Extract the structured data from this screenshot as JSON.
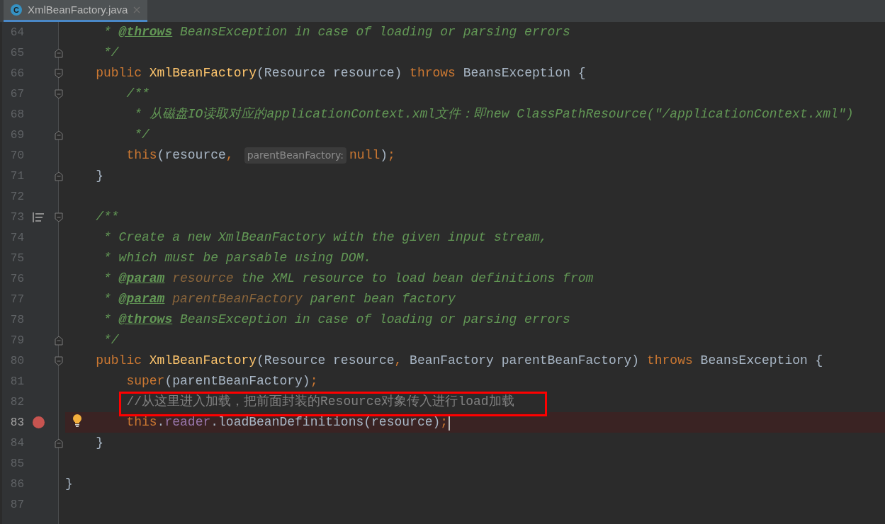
{
  "tab": {
    "icon_letter": "C",
    "title": "XmlBeanFactory.java",
    "selected": true
  },
  "lines": [
    {
      "number": "64",
      "breakpoint": false,
      "bulb": false,
      "doc_toggle": false,
      "boxed": false,
      "caret": false,
      "tokens": [
        {
          "kind": "doc",
          "text": "     * "
        },
        {
          "kind": "doctag",
          "text": "@throws"
        },
        {
          "kind": "doc",
          "text": " BeansException in case of loading or parsing errors"
        }
      ]
    },
    {
      "number": "65",
      "fold": {
        "kind": "end"
      },
      "breakpoint": false,
      "bulb": false,
      "doc_toggle": false,
      "boxed": false,
      "caret": false,
      "tokens": [
        {
          "kind": "doc",
          "text": "     */"
        }
      ]
    },
    {
      "number": "66",
      "fold": {
        "kind": "start"
      },
      "breakpoint": false,
      "bulb": false,
      "doc_toggle": false,
      "boxed": false,
      "caret": false,
      "tokens": [
        {
          "kind": "kw",
          "text": "    public "
        },
        {
          "kind": "fn",
          "text": "XmlBeanFactory"
        },
        {
          "kind": "plain",
          "text": "(Resource resource) "
        },
        {
          "kind": "kw",
          "text": "throws "
        },
        {
          "kind": "plain",
          "text": "BeansException {"
        }
      ]
    },
    {
      "number": "67",
      "fold": {
        "kind": "start"
      },
      "breakpoint": false,
      "bulb": false,
      "doc_toggle": false,
      "boxed": false,
      "caret": false,
      "tokens": [
        {
          "kind": "doc",
          "text": "        /**"
        }
      ]
    },
    {
      "number": "68",
      "breakpoint": false,
      "bulb": false,
      "doc_toggle": false,
      "boxed": false,
      "caret": false,
      "tokens": [
        {
          "kind": "doc",
          "text": "         * 从磁盘IO读取对应的applicationContext.xml文件：即new ClassPathResource(\"/applicationContext.xml\")"
        }
      ]
    },
    {
      "number": "69",
      "fold": {
        "kind": "end"
      },
      "breakpoint": false,
      "bulb": false,
      "doc_toggle": false,
      "boxed": false,
      "caret": false,
      "tokens": [
        {
          "kind": "doc",
          "text": "         */"
        }
      ]
    },
    {
      "number": "70",
      "breakpoint": false,
      "bulb": false,
      "doc_toggle": false,
      "boxed": false,
      "caret": false,
      "tokens": [
        {
          "kind": "kw",
          "text": "        this"
        },
        {
          "kind": "plain",
          "text": "(resource"
        },
        {
          "kind": "kw",
          "text": ","
        },
        {
          "kind": "hint",
          "text": "parentBeanFactory:"
        },
        {
          "kind": "kw",
          "text": "null"
        },
        {
          "kind": "plain",
          "text": ")"
        },
        {
          "kind": "kw",
          "text": ";"
        }
      ]
    },
    {
      "number": "71",
      "fold": {
        "kind": "end"
      },
      "breakpoint": false,
      "bulb": false,
      "doc_toggle": false,
      "boxed": false,
      "caret": false,
      "tokens": [
        {
          "kind": "plain",
          "text": "    }"
        }
      ]
    },
    {
      "number": "72",
      "breakpoint": false,
      "bulb": false,
      "doc_toggle": false,
      "boxed": false,
      "caret": false
    },
    {
      "number": "73",
      "fold": {
        "kind": "start"
      },
      "breakpoint": false,
      "bulb": false,
      "doc_toggle": true,
      "boxed": false,
      "caret": false,
      "tokens": [
        {
          "kind": "doc",
          "text": "    /**"
        }
      ]
    },
    {
      "number": "74",
      "breakpoint": false,
      "bulb": false,
      "doc_toggle": false,
      "boxed": false,
      "caret": false,
      "tokens": [
        {
          "kind": "doc",
          "text": "     * Create a new XmlBeanFactory with the given input stream,"
        }
      ]
    },
    {
      "number": "75",
      "breakpoint": false,
      "bulb": false,
      "doc_toggle": false,
      "boxed": false,
      "caret": false,
      "tokens": [
        {
          "kind": "doc",
          "text": "     * which must be parsable using DOM."
        }
      ]
    },
    {
      "number": "76",
      "breakpoint": false,
      "bulb": false,
      "doc_toggle": false,
      "boxed": false,
      "caret": false,
      "tokens": [
        {
          "kind": "doc",
          "text": "     * "
        },
        {
          "kind": "doctag",
          "text": "@param"
        },
        {
          "kind": "docref",
          "text": " resource"
        },
        {
          "kind": "doc",
          "text": " the XML resource to load bean definitions from"
        }
      ]
    },
    {
      "number": "77",
      "breakpoint": false,
      "bulb": false,
      "doc_toggle": false,
      "boxed": false,
      "caret": false,
      "tokens": [
        {
          "kind": "doc",
          "text": "     * "
        },
        {
          "kind": "doctag",
          "text": "@param"
        },
        {
          "kind": "docref",
          "text": " parentBeanFactory"
        },
        {
          "kind": "doc",
          "text": " parent bean factory"
        }
      ]
    },
    {
      "number": "78",
      "breakpoint": false,
      "bulb": false,
      "doc_toggle": false,
      "boxed": false,
      "caret": false,
      "tokens": [
        {
          "kind": "doc",
          "text": "     * "
        },
        {
          "kind": "doctag",
          "text": "@throws"
        },
        {
          "kind": "doc",
          "text": " BeansException in case of loading or parsing errors"
        }
      ]
    },
    {
      "number": "79",
      "fold": {
        "kind": "end"
      },
      "breakpoint": false,
      "bulb": false,
      "doc_toggle": false,
      "boxed": false,
      "caret": false,
      "tokens": [
        {
          "kind": "doc",
          "text": "     */"
        }
      ]
    },
    {
      "number": "80",
      "fold": {
        "kind": "start"
      },
      "breakpoint": false,
      "bulb": false,
      "doc_toggle": false,
      "boxed": false,
      "caret": false,
      "tokens": [
        {
          "kind": "kw",
          "text": "    public "
        },
        {
          "kind": "fn",
          "text": "XmlBeanFactory"
        },
        {
          "kind": "plain",
          "text": "(Resource resource"
        },
        {
          "kind": "kw",
          "text": ", "
        },
        {
          "kind": "plain",
          "text": "BeanFactory parentBeanFactory) "
        },
        {
          "kind": "kw",
          "text": "throws "
        },
        {
          "kind": "plain",
          "text": "BeansException {"
        }
      ]
    },
    {
      "number": "81",
      "breakpoint": false,
      "bulb": false,
      "doc_toggle": false,
      "boxed": false,
      "caret": false,
      "tokens": [
        {
          "kind": "kw",
          "text": "        super"
        },
        {
          "kind": "plain",
          "text": "(parentBeanFactory)"
        },
        {
          "kind": "kw",
          "text": ";"
        }
      ]
    },
    {
      "number": "82",
      "breakpoint": false,
      "bulb": false,
      "doc_toggle": false,
      "boxed": true,
      "caret": false,
      "tokens": [
        {
          "kind": "linecomment",
          "text": "        //从这里进入加载，把前面封装的Resource对象传入进行load加载"
        }
      ]
    },
    {
      "number": "83",
      "breakpoint": true,
      "bulb": true,
      "doc_toggle": false,
      "boxed": false,
      "caret": true,
      "tokens": [
        {
          "kind": "kw",
          "text": "        this"
        },
        {
          "kind": "plain",
          "text": "."
        },
        {
          "kind": "field",
          "text": "reader"
        },
        {
          "kind": "plain",
          "text": ".loadBeanDefinitions(resource)"
        },
        {
          "kind": "kw",
          "text": ";"
        }
      ]
    },
    {
      "number": "84",
      "fold": {
        "kind": "end"
      },
      "breakpoint": false,
      "bulb": false,
      "doc_toggle": false,
      "boxed": false,
      "caret": false,
      "tokens": [
        {
          "kind": "plain",
          "text": "    }"
        }
      ]
    },
    {
      "number": "85",
      "breakpoint": false,
      "bulb": false,
      "doc_toggle": false,
      "boxed": false,
      "caret": false
    },
    {
      "number": "86",
      "breakpoint": false,
      "bulb": false,
      "doc_toggle": false,
      "boxed": false,
      "caret": false,
      "tokens": [
        {
          "kind": "plain",
          "text": "}"
        }
      ]
    },
    {
      "number": "87",
      "breakpoint": false,
      "bulb": false,
      "doc_toggle": false,
      "boxed": false,
      "caret": false
    }
  ]
}
